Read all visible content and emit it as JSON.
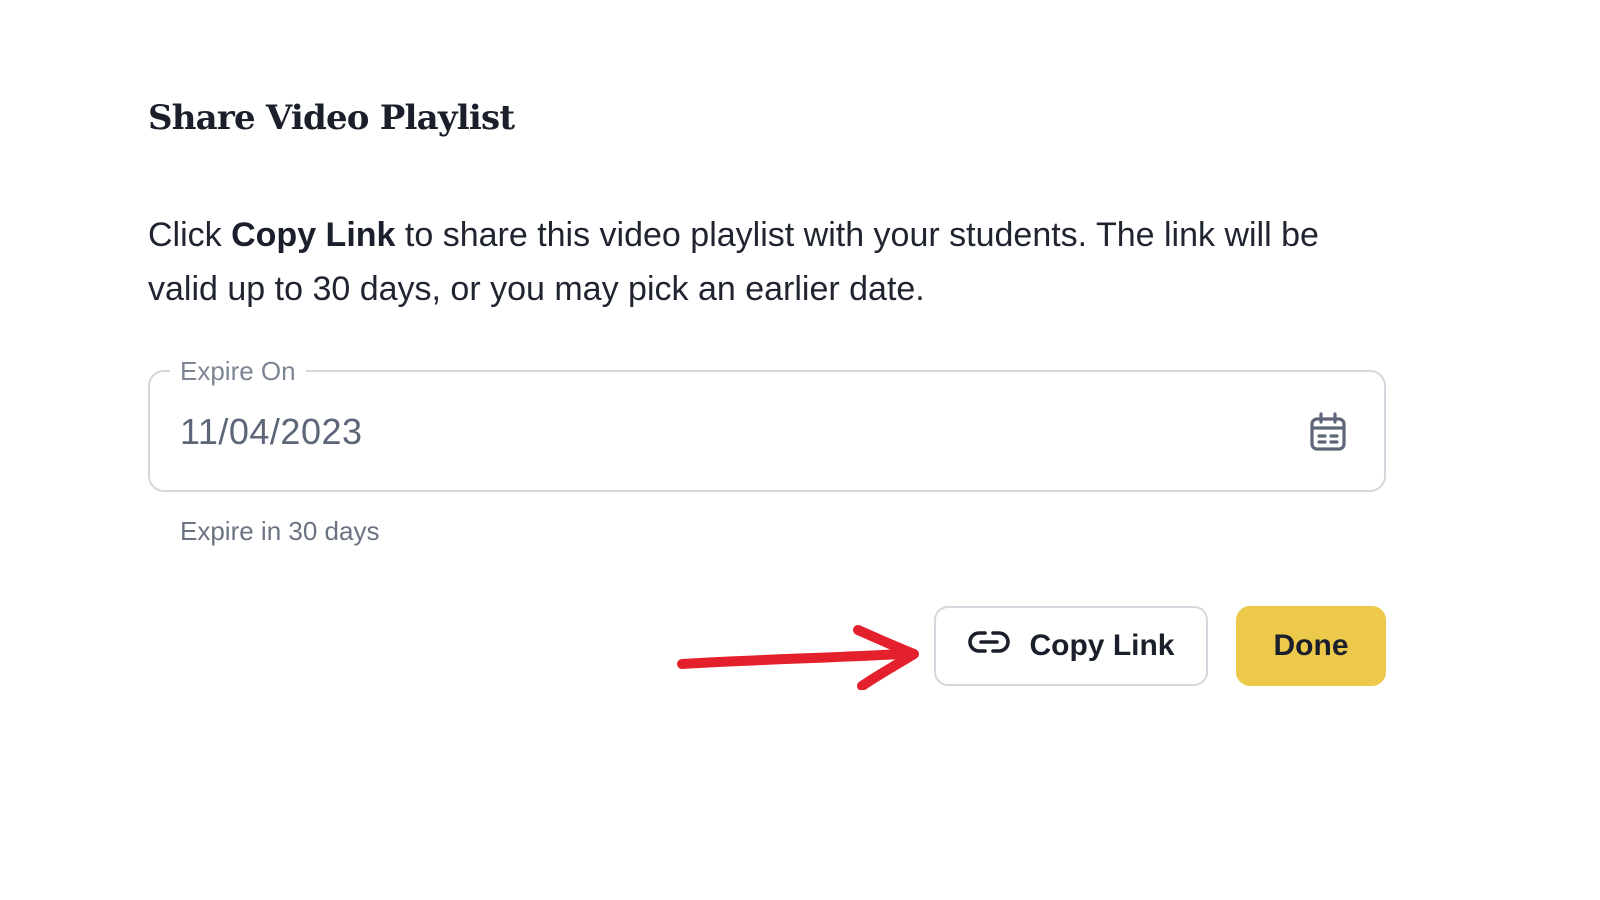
{
  "dialog": {
    "title": "Share Video Playlist",
    "description_pre": "Click ",
    "description_bold": "Copy Link",
    "description_post": " to share this video playlist with your students. The link will be valid up to 30 days, or you may pick an earlier date."
  },
  "expire_field": {
    "label": "Expire On",
    "value": "11/04/2023",
    "icon": "calendar-icon",
    "helper_text": "Expire in 30 days"
  },
  "actions": {
    "copy_link_label": "Copy Link",
    "copy_link_icon": "link-icon",
    "done_label": "Done"
  },
  "annotation": {
    "type": "hand-drawn arrow",
    "color": "#e3202b",
    "points_to": "copy-link-button"
  },
  "colors": {
    "done_button": "#ecc94b",
    "text_dark": "#1a1f2b",
    "field_border": "#d4d7dd",
    "muted_text": "#7d8594"
  }
}
